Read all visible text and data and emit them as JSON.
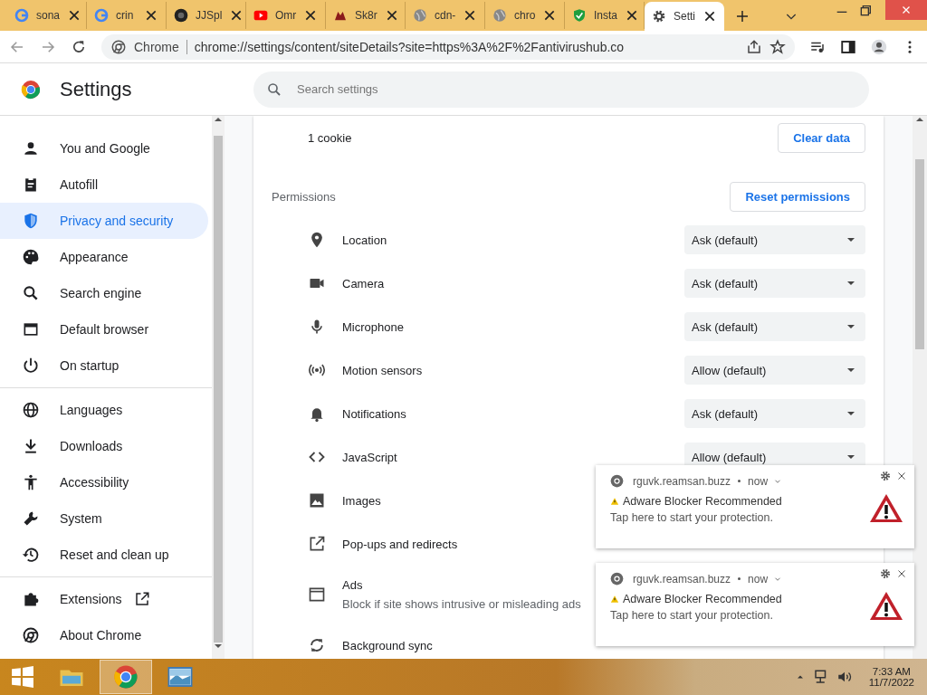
{
  "tabs": [
    {
      "title": "sona",
      "selected": false
    },
    {
      "title": "crin",
      "selected": false
    },
    {
      "title": "JJSpl",
      "selected": false
    },
    {
      "title": "Omr",
      "selected": false
    },
    {
      "title": "Sk8r",
      "selected": false
    },
    {
      "title": "cdn-",
      "selected": false
    },
    {
      "title": "chro",
      "selected": false
    },
    {
      "title": "Insta",
      "selected": false
    },
    {
      "title": "Setti",
      "selected": true
    }
  ],
  "toolbar": {
    "site_label": "Chrome",
    "url": "chrome://settings/content/siteDetails?site=https%3A%2F%2Fantivirushub.co"
  },
  "header": {
    "title": "Settings",
    "search_placeholder": "Search settings"
  },
  "sidebar": {
    "groups": [
      [
        {
          "label": "You and Google",
          "selected": false
        },
        {
          "label": "Autofill",
          "selected": false
        },
        {
          "label": "Privacy and security",
          "selected": true
        },
        {
          "label": "Appearance",
          "selected": false
        },
        {
          "label": "Search engine",
          "selected": false
        },
        {
          "label": "Default browser",
          "selected": false
        },
        {
          "label": "On startup",
          "selected": false
        }
      ],
      [
        {
          "label": "Languages",
          "selected": false
        },
        {
          "label": "Downloads",
          "selected": false
        },
        {
          "label": "Accessibility",
          "selected": false
        },
        {
          "label": "System",
          "selected": false
        },
        {
          "label": "Reset and clean up",
          "selected": false
        }
      ],
      [
        {
          "label": "Extensions",
          "selected": false,
          "kind": "external"
        },
        {
          "label": "About Chrome",
          "selected": false,
          "kind": "plain"
        }
      ]
    ]
  },
  "content": {
    "cookies": "1 cookie",
    "clear_button": "Clear data",
    "permissions_title": "Permissions",
    "reset_button": "Reset permissions",
    "permissions": [
      {
        "name": "Location",
        "value": "Ask (default)"
      },
      {
        "name": "Camera",
        "value": "Ask (default)"
      },
      {
        "name": "Microphone",
        "value": "Ask (default)"
      },
      {
        "name": "Motion sensors",
        "value": "Allow (default)"
      },
      {
        "name": "Notifications",
        "value": "Ask (default)"
      },
      {
        "name": "JavaScript",
        "value": "Allow (default)"
      },
      {
        "name": "Images"
      },
      {
        "name": "Pop-ups and redirects"
      },
      {
        "name": "Ads",
        "description": "Block if site shows intrusive or misleading ads"
      },
      {
        "name": "Background sync"
      }
    ]
  },
  "notifications": [
    {
      "source": "rguvk.reamsan.buzz",
      "time": "now",
      "title": "Adware Blocker Recommended",
      "body": "Tap here to start your protection."
    },
    {
      "source": "rguvk.reamsan.buzz",
      "time": "now",
      "title": "Adware Blocker Recommended",
      "body": "Tap here to start your protection."
    }
  ],
  "taskbar": {
    "apps": [
      {
        "selected": false
      },
      {
        "selected": true
      },
      {
        "selected": false
      }
    ],
    "time": "7:33 AM",
    "date": "11/7/2022"
  }
}
